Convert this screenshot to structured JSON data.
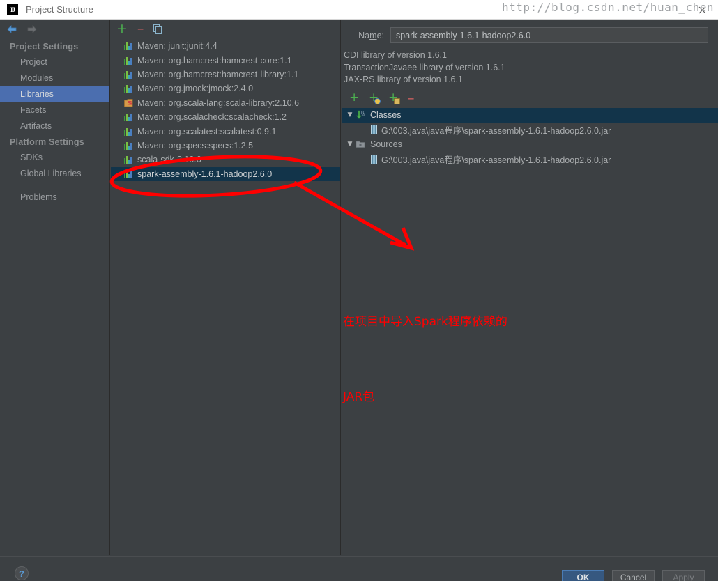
{
  "window": {
    "title": "Project Structure",
    "logo_icon": "intellij-idea-logo",
    "close_icon": "close-icon"
  },
  "sidebar": {
    "back_icon": "back-arrow-icon",
    "forward_icon": "forward-arrow-icon",
    "groups": [
      {
        "title": "Project Settings",
        "items": [
          {
            "label": "Project",
            "selected": false
          },
          {
            "label": "Modules",
            "selected": false
          },
          {
            "label": "Libraries",
            "selected": true
          },
          {
            "label": "Facets",
            "selected": false
          },
          {
            "label": "Artifacts",
            "selected": false
          }
        ]
      },
      {
        "title": "Platform Settings",
        "items": [
          {
            "label": "SDKs",
            "selected": false
          },
          {
            "label": "Global Libraries",
            "selected": false
          }
        ]
      }
    ],
    "problems_label": "Problems"
  },
  "library_list": {
    "toolbar": {
      "add_icon": "plus-icon",
      "remove_icon": "minus-icon",
      "copy_icon": "copy-icon"
    },
    "items": [
      {
        "label": "Maven: junit:junit:4.4",
        "icon": "library-bars-icon",
        "selected": false
      },
      {
        "label": "Maven: org.hamcrest:hamcrest-core:1.1",
        "icon": "library-bars-icon",
        "selected": false
      },
      {
        "label": "Maven: org.hamcrest:hamcrest-library:1.1",
        "icon": "library-bars-icon",
        "selected": false
      },
      {
        "label": "Maven: org.jmock:jmock:2.4.0",
        "icon": "library-bars-icon",
        "selected": false
      },
      {
        "label": "Maven: org.scala-lang:scala-library:2.10.6",
        "icon": "scala-sdk-icon",
        "selected": false
      },
      {
        "label": "Maven: org.scalacheck:scalacheck:1.2",
        "icon": "library-bars-icon",
        "selected": false
      },
      {
        "label": "Maven: org.scalatest:scalatest:0.9.1",
        "icon": "library-bars-icon",
        "selected": false
      },
      {
        "label": "Maven: org.specs:specs:1.2.5",
        "icon": "library-bars-icon",
        "selected": false
      },
      {
        "label": "scala-sdk-2.10.6",
        "icon": "library-bars-icon",
        "selected": false
      },
      {
        "label": "spark-assembly-1.6.1-hadoop2.6.0",
        "icon": "library-bars-icon",
        "selected": true
      }
    ]
  },
  "detail": {
    "name_label_pre": "Na",
    "name_label_mnemonic": "m",
    "name_label_post": "e:",
    "name_value": "spark-assembly-1.6.1-hadoop2.6.0",
    "descriptions": [
      "CDI library of version 1.6.1",
      "TransactionJavaee library of version 1.6.1",
      "JAX-RS library of version 1.6.1"
    ],
    "tree_toolbar": {
      "add_icon": "plus-icon",
      "attach_url_icon": "plus-globe-icon",
      "attach_jar_icon": "plus-jar-icon",
      "remove_icon": "minus-icon"
    },
    "tree": [
      {
        "label": "Classes",
        "icon": "classes-icon",
        "expanded": true,
        "selected": true,
        "twisty": "▼",
        "children": [
          {
            "label": "G:\\003.java\\java程序\\spark-assembly-1.6.1-hadoop2.6.0.jar",
            "icon": "jar-icon"
          }
        ]
      },
      {
        "label": "Sources",
        "icon": "sources-folder-icon",
        "expanded": true,
        "selected": false,
        "twisty": "▼",
        "children": [
          {
            "label": "G:\\003.java\\java程序\\spark-assembly-1.6.1-hadoop2.6.0.jar",
            "icon": "jar-icon"
          }
        ]
      }
    ]
  },
  "annotation": {
    "line1": "在项目中导入Spark程序依赖的",
    "line2": "JAR包",
    "color": "#ff0000",
    "ellipse_target": "spark-assembly-1.6.1-hadoop2.6.0",
    "arrow": "red-arrow-icon",
    "ellipse": "red-ellipse-icon"
  },
  "bottombar": {
    "help_label": "?",
    "watermark": "http://blog.csdn.net/huan_chen",
    "buttons": [
      {
        "label": "OK",
        "style": "default"
      },
      {
        "label": "Cancel",
        "style": "normal"
      },
      {
        "label": "Apply",
        "style": "disabled"
      }
    ]
  },
  "colors": {
    "selection_blue": "#4b6eaf",
    "tree_selection": "#12344a",
    "panel_bg": "#3c4043",
    "accent_green": "#4caf50",
    "annotation_red": "#ff0000"
  }
}
